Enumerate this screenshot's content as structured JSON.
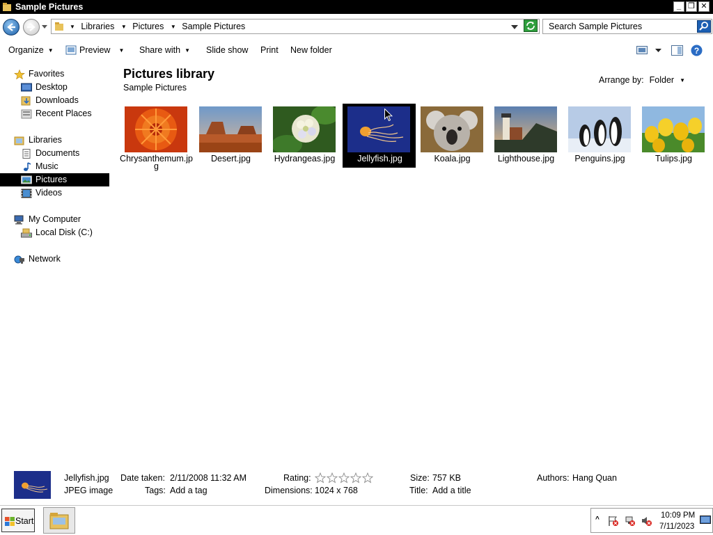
{
  "window": {
    "title": "Sample Pictures"
  },
  "address": {
    "crumbs": [
      "Libraries",
      "Pictures",
      "Sample Pictures"
    ],
    "search_placeholder": "Search Sample Pictures"
  },
  "toolbar": {
    "organize": "Organize",
    "preview": "Preview",
    "share_with": "Share with",
    "slide_show": "Slide show",
    "print": "Print",
    "new_folder": "New folder"
  },
  "nav": {
    "favorites": "Favorites",
    "desktop": "Desktop",
    "downloads": "Downloads",
    "recent_places": "Recent Places",
    "libraries": "Libraries",
    "documents": "Documents",
    "music": "Music",
    "pictures": "Pictures",
    "videos": "Videos",
    "my_computer": "My Computer",
    "local_disk": "Local Disk (C:)",
    "network": "Network"
  },
  "content": {
    "title": "Pictures library",
    "subtitle": "Sample Pictures",
    "arrange_label": "Arrange by:",
    "arrange_value": "Folder",
    "files": [
      {
        "name": "Chrysanthemum.jpg"
      },
      {
        "name": "Desert.jpg"
      },
      {
        "name": "Hydrangeas.jpg"
      },
      {
        "name": "Jellyfish.jpg"
      },
      {
        "name": "Koala.jpg"
      },
      {
        "name": "Lighthouse.jpg"
      },
      {
        "name": "Penguins.jpg"
      },
      {
        "name": "Tulips.jpg"
      }
    ]
  },
  "details": {
    "filename": "Jellyfish.jpg",
    "filetype": "JPEG image",
    "date_taken_label": "Date taken:",
    "date_taken": "2/11/2008 11:32 AM",
    "tags_label": "Tags:",
    "tags": "Add a tag",
    "rating_label": "Rating:",
    "dimensions_label": "Dimensions:",
    "dimensions": "1024 x 768",
    "size_label": "Size:",
    "size": "757 KB",
    "title_label": "Title:",
    "title": "Add a title",
    "authors_label": "Authors:",
    "authors": "Hang Quan"
  },
  "taskbar": {
    "start": "Start",
    "time": "10:09 PM",
    "date": "7/11/2023"
  }
}
